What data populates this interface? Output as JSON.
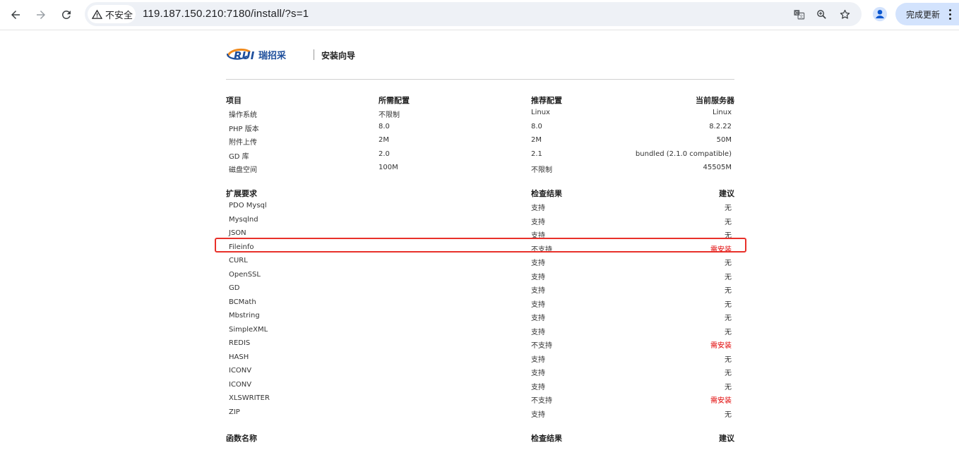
{
  "browser": {
    "security_label": "不安全",
    "url": "119.187.150.210:7180/install/?s=1",
    "update_label": "完成更新"
  },
  "header": {
    "logo_text": "ERUI瑞招采",
    "title": "安装向导"
  },
  "colors": {
    "logo_blue": "#1e4f9c",
    "logo_orange": "#f08a1c",
    "warn": "#e00000",
    "highlight_border": "#e8302a"
  },
  "env_table": {
    "headers": [
      "项目",
      "所需配置",
      "推荐配置",
      "当前服务器"
    ],
    "rows": [
      [
        "操作系统",
        "不限制",
        "Linux",
        "Linux"
      ],
      [
        "PHP 版本",
        "8.0",
        "8.0",
        "8.2.22"
      ],
      [
        "附件上传",
        "2M",
        "2M",
        "50M"
      ],
      [
        "GD 库",
        "2.0",
        "2.1",
        "bundled (2.1.0 compatible)"
      ],
      [
        "磁盘空间",
        "100M",
        "不限制",
        "45505M"
      ]
    ]
  },
  "ext_table": {
    "headers": [
      "扩展要求",
      "检查结果",
      "建议"
    ],
    "rows": [
      {
        "name": "PDO Mysql",
        "result": "支持",
        "advice": "无",
        "warn": false
      },
      {
        "name": "Mysqlnd",
        "result": "支持",
        "advice": "无",
        "warn": false
      },
      {
        "name": "JSON",
        "result": "支持",
        "advice": "无",
        "warn": false
      },
      {
        "name": "Fileinfo",
        "result": "不支持",
        "advice": "需安装",
        "warn": true
      },
      {
        "name": "CURL",
        "result": "支持",
        "advice": "无",
        "warn": false
      },
      {
        "name": "OpenSSL",
        "result": "支持",
        "advice": "无",
        "warn": false
      },
      {
        "name": "GD",
        "result": "支持",
        "advice": "无",
        "warn": false
      },
      {
        "name": "BCMath",
        "result": "支持",
        "advice": "无",
        "warn": false
      },
      {
        "name": "Mbstring",
        "result": "支持",
        "advice": "无",
        "warn": false
      },
      {
        "name": "SimpleXML",
        "result": "支持",
        "advice": "无",
        "warn": false
      },
      {
        "name": "REDIS",
        "result": "不支持",
        "advice": "需安装",
        "warn": true
      },
      {
        "name": "HASH",
        "result": "支持",
        "advice": "无",
        "warn": false
      },
      {
        "name": "ICONV",
        "result": "支持",
        "advice": "无",
        "warn": false
      },
      {
        "name": "ICONV",
        "result": "支持",
        "advice": "无",
        "warn": false
      },
      {
        "name": "XLSWRITER",
        "result": "不支持",
        "advice": "需安装",
        "warn": true
      },
      {
        "name": "ZIP",
        "result": "支持",
        "advice": "无",
        "warn": false
      }
    ]
  },
  "func_table": {
    "headers": [
      "函数名称",
      "检查结果",
      "建议"
    ]
  }
}
